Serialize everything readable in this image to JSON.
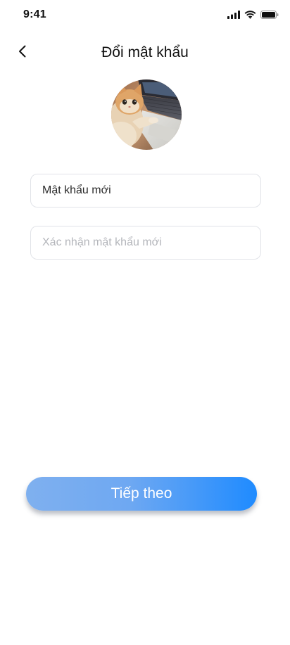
{
  "status_bar": {
    "time": "9:41",
    "signal_icon": "cellular-signal-icon",
    "wifi_icon": "wifi-icon",
    "battery_icon": "battery-icon"
  },
  "header": {
    "back_icon": "chevron-left-icon",
    "title": "Đổi mật khẩu"
  },
  "avatar": {
    "description_icon": "user-avatar-cat-photo"
  },
  "form": {
    "new_password": {
      "placeholder": "Mật khẩu mới",
      "value": ""
    },
    "confirm_password": {
      "placeholder": "Xác nhận mật khẩu mới",
      "value": ""
    }
  },
  "actions": {
    "next_label": "Tiếp theo"
  },
  "colors": {
    "button_gradient_start": "#7fb0ef",
    "button_gradient_end": "#1f8bff",
    "field_border": "#e1e3e8",
    "placeholder": "#b4b6bb"
  }
}
